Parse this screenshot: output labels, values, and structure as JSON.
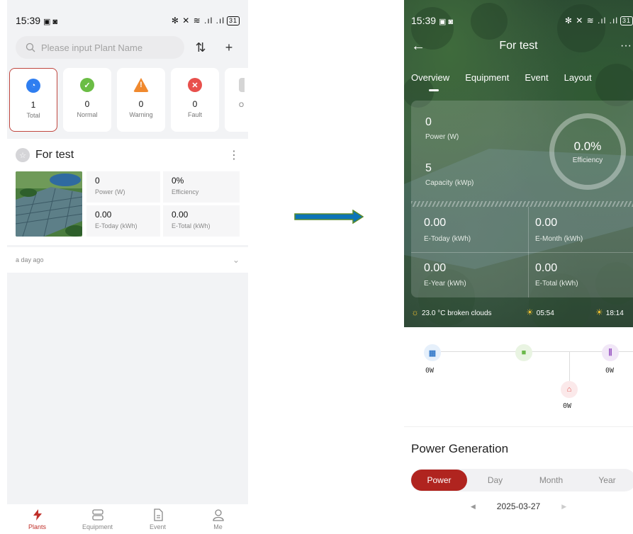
{
  "left": {
    "status_bar": {
      "time": "15:39",
      "left_icons": "▣ ◙",
      "right_icons": "✻ ✕ ≋ .ıl .ıl",
      "battery": "31"
    },
    "search": {
      "placeholder": "Please input Plant Name"
    },
    "status_cards": [
      {
        "label": "Total",
        "count": "1",
        "color": "#2f7ef0",
        "selected": true
      },
      {
        "label": "Normal",
        "count": "0",
        "color": "#6bbd45"
      },
      {
        "label": "Warning",
        "count": "0",
        "color": "#f0892e"
      },
      {
        "label": "Fault",
        "count": "0",
        "color": "#e8504c"
      },
      {
        "label": "O",
        "count": "",
        "color": "#bbbbbb"
      }
    ],
    "plant": {
      "name": "For test",
      "power_value": "0",
      "power_label": "Power (W)",
      "efficiency_value": "0%",
      "efficiency_label": "Efficiency",
      "etoday_value": "0.00",
      "etoday_label": "E-Today (kWh)",
      "etotal_value": "0.00",
      "etotal_label": "E-Total (kWh)",
      "updated": "a day ago"
    },
    "nav": [
      {
        "label": "Plants",
        "icon": "lightning-icon",
        "active": true
      },
      {
        "label": "Equipment",
        "icon": "server-icon"
      },
      {
        "label": "Event",
        "icon": "document-icon"
      },
      {
        "label": "Me",
        "icon": "user-icon"
      }
    ]
  },
  "right": {
    "status_bar": {
      "time": "15:39",
      "left_icons": "▣ ◙",
      "right_icons": "✻ ✕ ≋ .ıl .ıl",
      "battery": "31"
    },
    "title": "For test",
    "tabs": [
      "Overview",
      "Equipment",
      "Event",
      "Layout"
    ],
    "overview": {
      "power_value": "0",
      "power_label": "Power (W)",
      "capacity_value": "5",
      "capacity_label": "Capacity (kWp)",
      "efficiency_value": "0.0%",
      "efficiency_label": "Efficiency",
      "etoday_value": "0.00",
      "etoday_label": "E-Today (kWh)",
      "emonth_value": "0.00",
      "emonth_label": "E-Month (kWh)",
      "eyear_value": "0.00",
      "eyear_label": "E-Year (kWh)",
      "etotal_value": "0.00",
      "etotal_label": "E-Total (kWh)"
    },
    "weather": {
      "text": "23.0 °C broken clouds",
      "sunrise": "05:54",
      "sunset": "18:14"
    },
    "flow": {
      "solar": "0W",
      "grid": "0W",
      "home": "0W"
    },
    "power_generation": {
      "title": "Power Generation",
      "segments": [
        "Power",
        "Day",
        "Month",
        "Year"
      ],
      "active_segment": "Power",
      "date": "2025-03-27"
    }
  },
  "colors": {
    "accent": "#b0241f",
    "selected_border": "#c0463e",
    "arrow_fill": "#0c74b8",
    "arrow_border": "#5a8a2a"
  }
}
